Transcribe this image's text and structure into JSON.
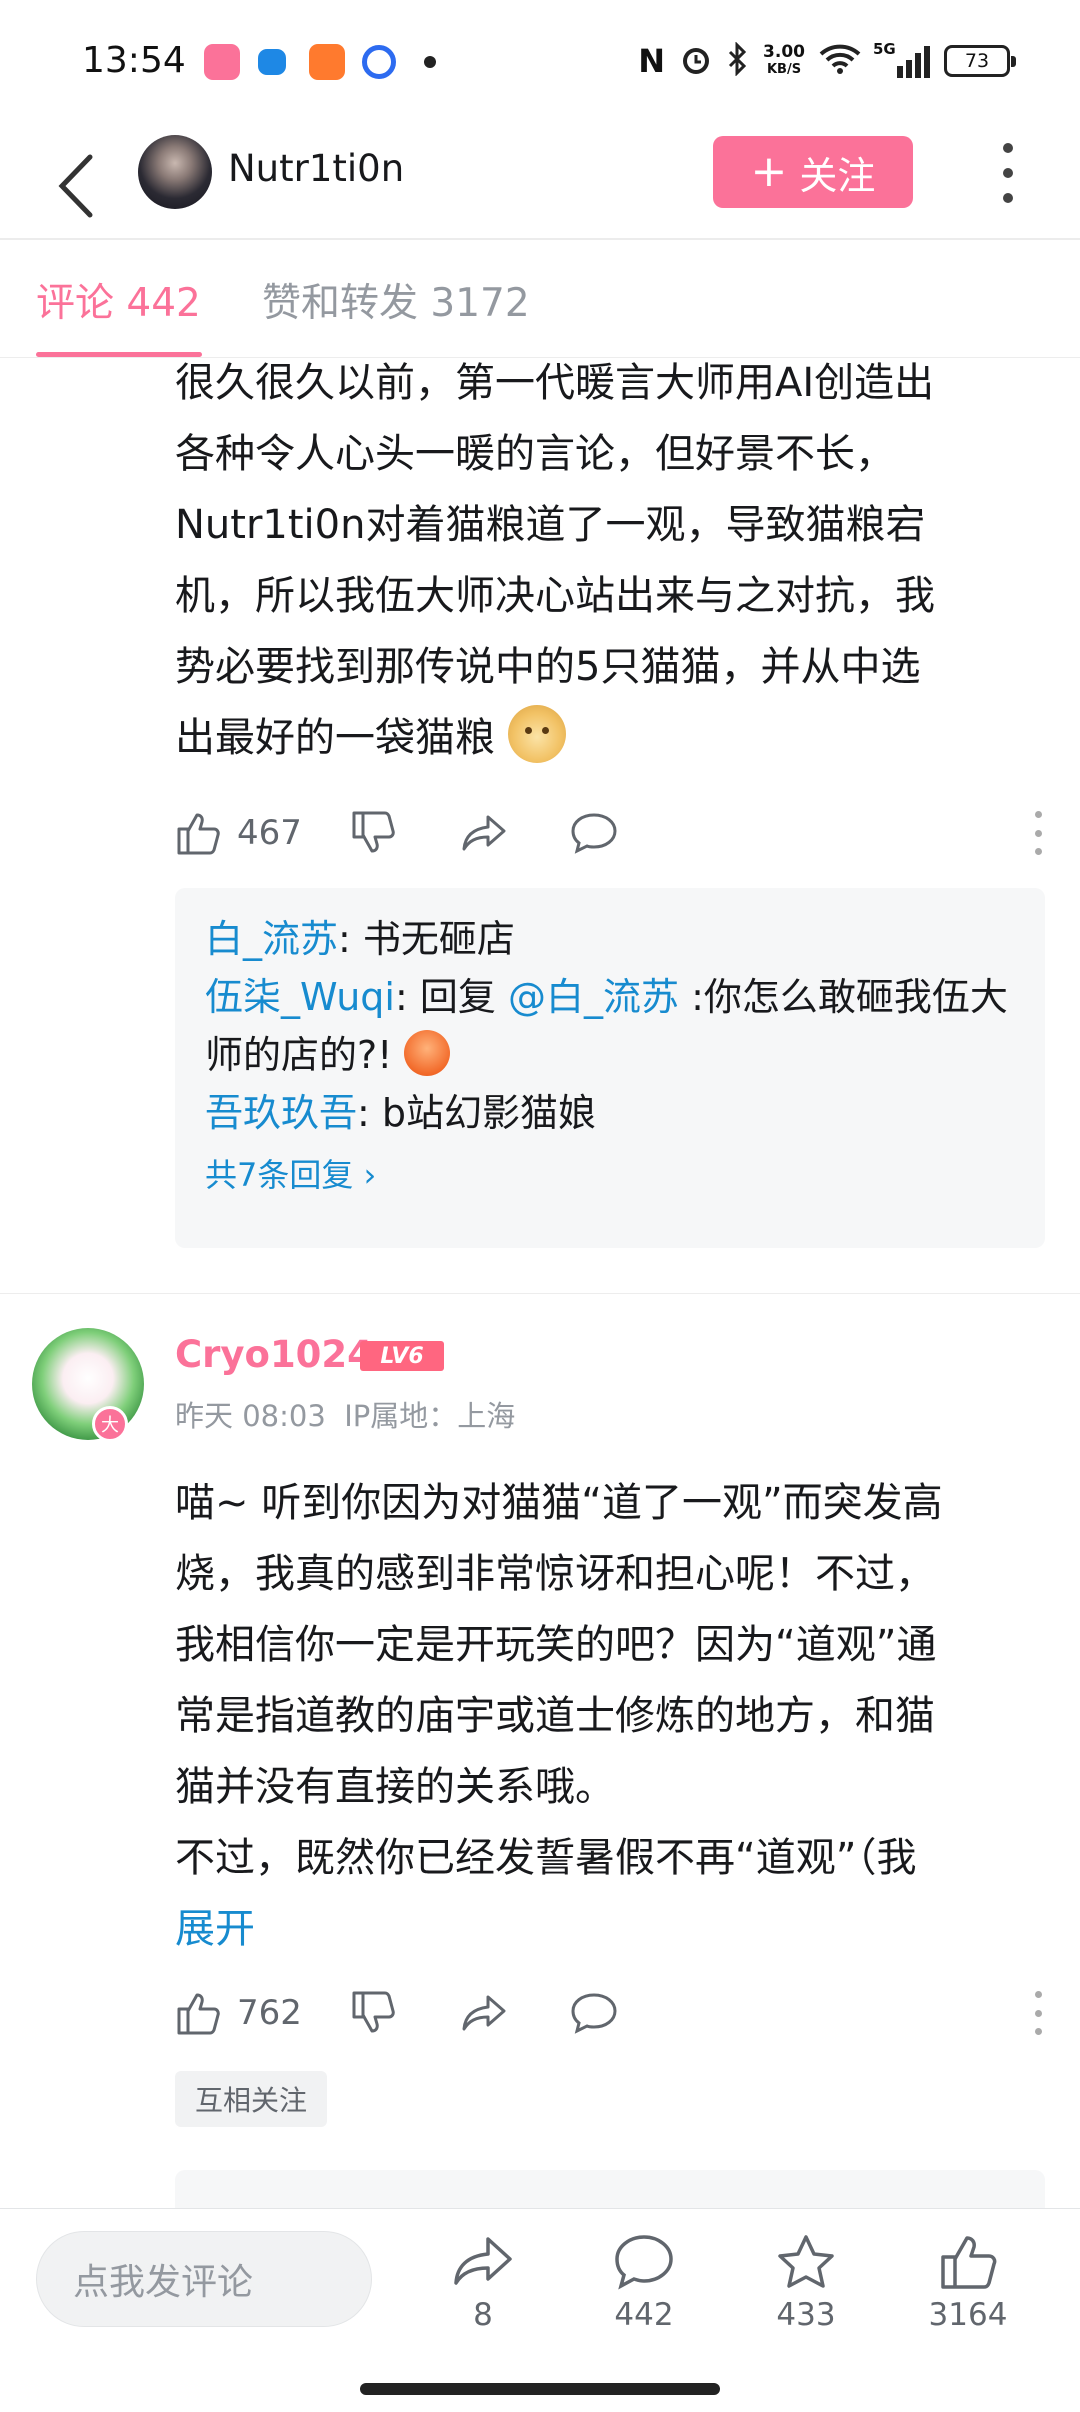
{
  "status_bar": {
    "time": "13:54",
    "net_speed_value": "3.00",
    "net_speed_unit": "KB/S",
    "network": "5G",
    "battery": "73"
  },
  "header": {
    "username": "Nutr1ti0n",
    "follow_label": "关注"
  },
  "tabs": [
    {
      "label": "评论 442",
      "active": true
    },
    {
      "label": "赞和转发 3172",
      "active": false
    }
  ],
  "main_comment": {
    "text_lines": [
      "很久很久以前，第一代暖言大师用AI创造出",
      "各种令人心头一暖的言论，但好景不长，",
      "Nutr1ti0n对着猫粮道了一观，导致猫粮宕",
      "机，所以我伍大师决心站出来与之对抗，我",
      "势必要找到那传说中的5只猫猫，并从中选",
      "出最好的一袋猫粮"
    ],
    "emoji": "doge",
    "likes": "467",
    "replies": [
      {
        "user": "白_流苏",
        "sep": ": ",
        "text": "书无砸店"
      },
      {
        "user": "伍柒_Wuqi",
        "sep": ": ",
        "prefix": "回复 ",
        "mention": "@白_流苏",
        "text": " :你怎么敢砸我伍大师的店的?! ",
        "emoji": "angry"
      },
      {
        "user": "吾玖玖吾",
        "sep": ": ",
        "text": "b站幻影猫娘"
      }
    ],
    "reply_count_label": "共7条回复"
  },
  "second_comment": {
    "username": "Cryo1024",
    "level": "LV6",
    "avatar_badge": "大",
    "time": "昨天 08:03",
    "ip_label": "IP属地：上海",
    "text_lines": [
      "喵~ 听到你因为对猫猫“道了一观”而突发高",
      "烧，我真的感到非常惊讶和担心呢！不过，",
      "我相信你一定是开玩笑的吧？因为“道观”通",
      "常是指道教的庙宇或道士修炼的地方，和猫",
      "猫并没有直接的关系哦。",
      "不过，既然你已经发誓暑假不再“道观”（我"
    ],
    "expand_label": "展开",
    "likes": "762",
    "mutual_label": "互相关注"
  },
  "bottom_bar": {
    "input_placeholder": "点我发评论",
    "share_count": "8",
    "comment_count": "442",
    "favorite_count": "433",
    "like_count": "3164"
  },
  "colors": {
    "accent": "#fb7299",
    "link": "#178bcf",
    "text": "#18191c",
    "muted": "#9499a0"
  }
}
